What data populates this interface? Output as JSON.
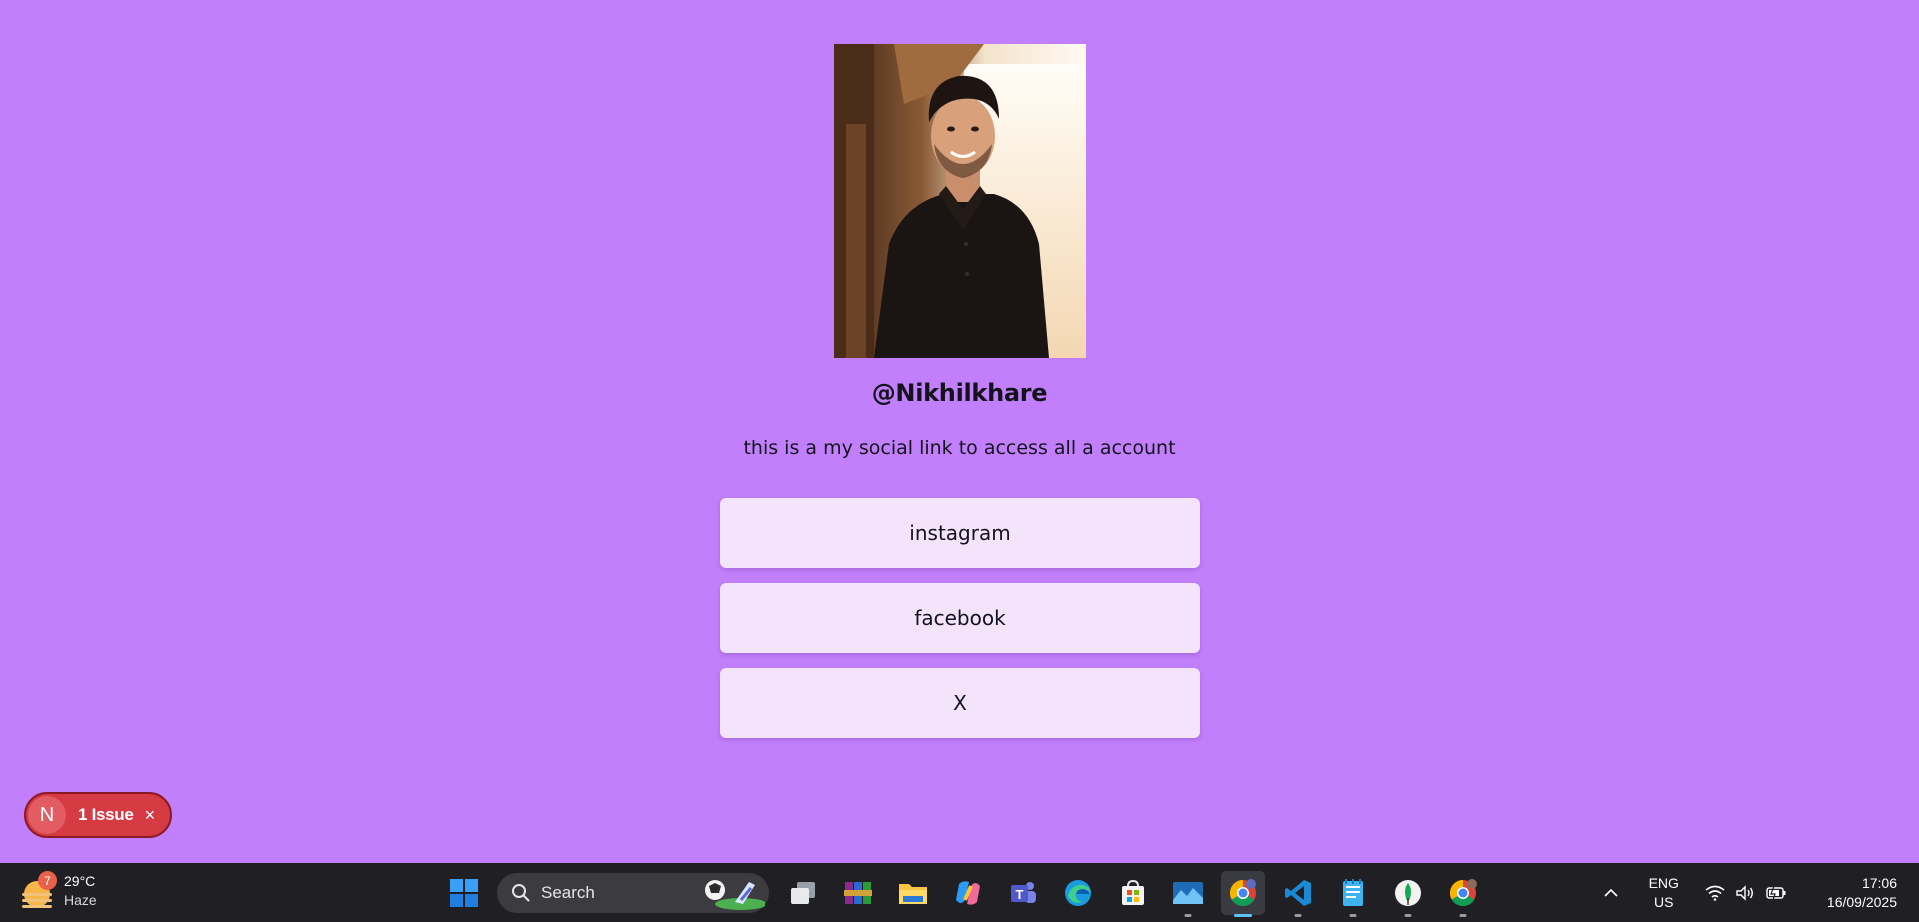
{
  "profile": {
    "handle": "@Nikhilkhare",
    "bio": "this is a my social link to access all a account",
    "photo_alt": "profile photo"
  },
  "links": [
    {
      "label": "instagram"
    },
    {
      "label": "facebook"
    },
    {
      "label": "X"
    }
  ],
  "issue_badge": {
    "letter": "N",
    "text": "1 Issue",
    "close": "×"
  },
  "taskbar": {
    "weather": {
      "badge": "7",
      "temp": "29°C",
      "condition": "Haze"
    },
    "search": {
      "label": "Search"
    },
    "apps": [
      "start-icon",
      "task-view-icon",
      "winrar-icon",
      "file-explorer-icon",
      "copilot-icon",
      "teams-icon",
      "edge-icon",
      "microsoft-store-icon",
      "mountain-app-icon",
      "chrome-icon",
      "vscode-icon",
      "notepad-icon",
      "mongodb-compass-icon",
      "chrome-profile-icon"
    ],
    "tray": {
      "lang_top": "ENG",
      "lang_bottom": "US",
      "time": "17:06",
      "date": "16/09/2025"
    }
  },
  "colors": {
    "page_bg": "#c17ffc",
    "button_bg": "#f3e4fc",
    "issue_red": "#d63a43",
    "taskbar_bg": "#1f1f24"
  }
}
